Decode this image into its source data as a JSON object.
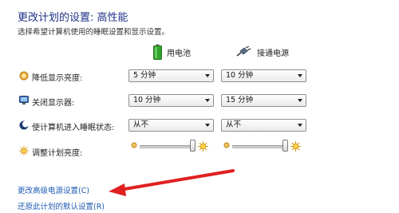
{
  "header": {
    "title": "更改计划的设置: 高性能",
    "subtitle": "选择希望计算机使用的睡眠设置和显示设置。"
  },
  "columns": {
    "on_battery": "用电池",
    "plugged_in": "接通电源"
  },
  "rows": [
    {
      "label": "降低显示亮度:",
      "icon": "dim-display-icon",
      "on_battery": "5 分钟",
      "plugged_in": "10 分钟"
    },
    {
      "label": "关闭显示器:",
      "icon": "monitor-icon",
      "on_battery": "10 分钟",
      "plugged_in": "15 分钟"
    },
    {
      "label": "使计算机进入睡眠状态:",
      "icon": "sleep-moon-icon",
      "on_battery": "从不",
      "plugged_in": "从不"
    }
  ],
  "brightness": {
    "label": "调整计划亮度:",
    "icon": "brightness-sun-icon",
    "on_battery_level": 1.0,
    "plugged_in_level": 1.0
  },
  "links": {
    "advanced": "更改高级电源设置(C)",
    "restore": "还原此计划的默认设置(R)"
  },
  "colors": {
    "title": "#1e3287",
    "link": "#1e5ab4",
    "annotation_arrow": "#e02020"
  }
}
